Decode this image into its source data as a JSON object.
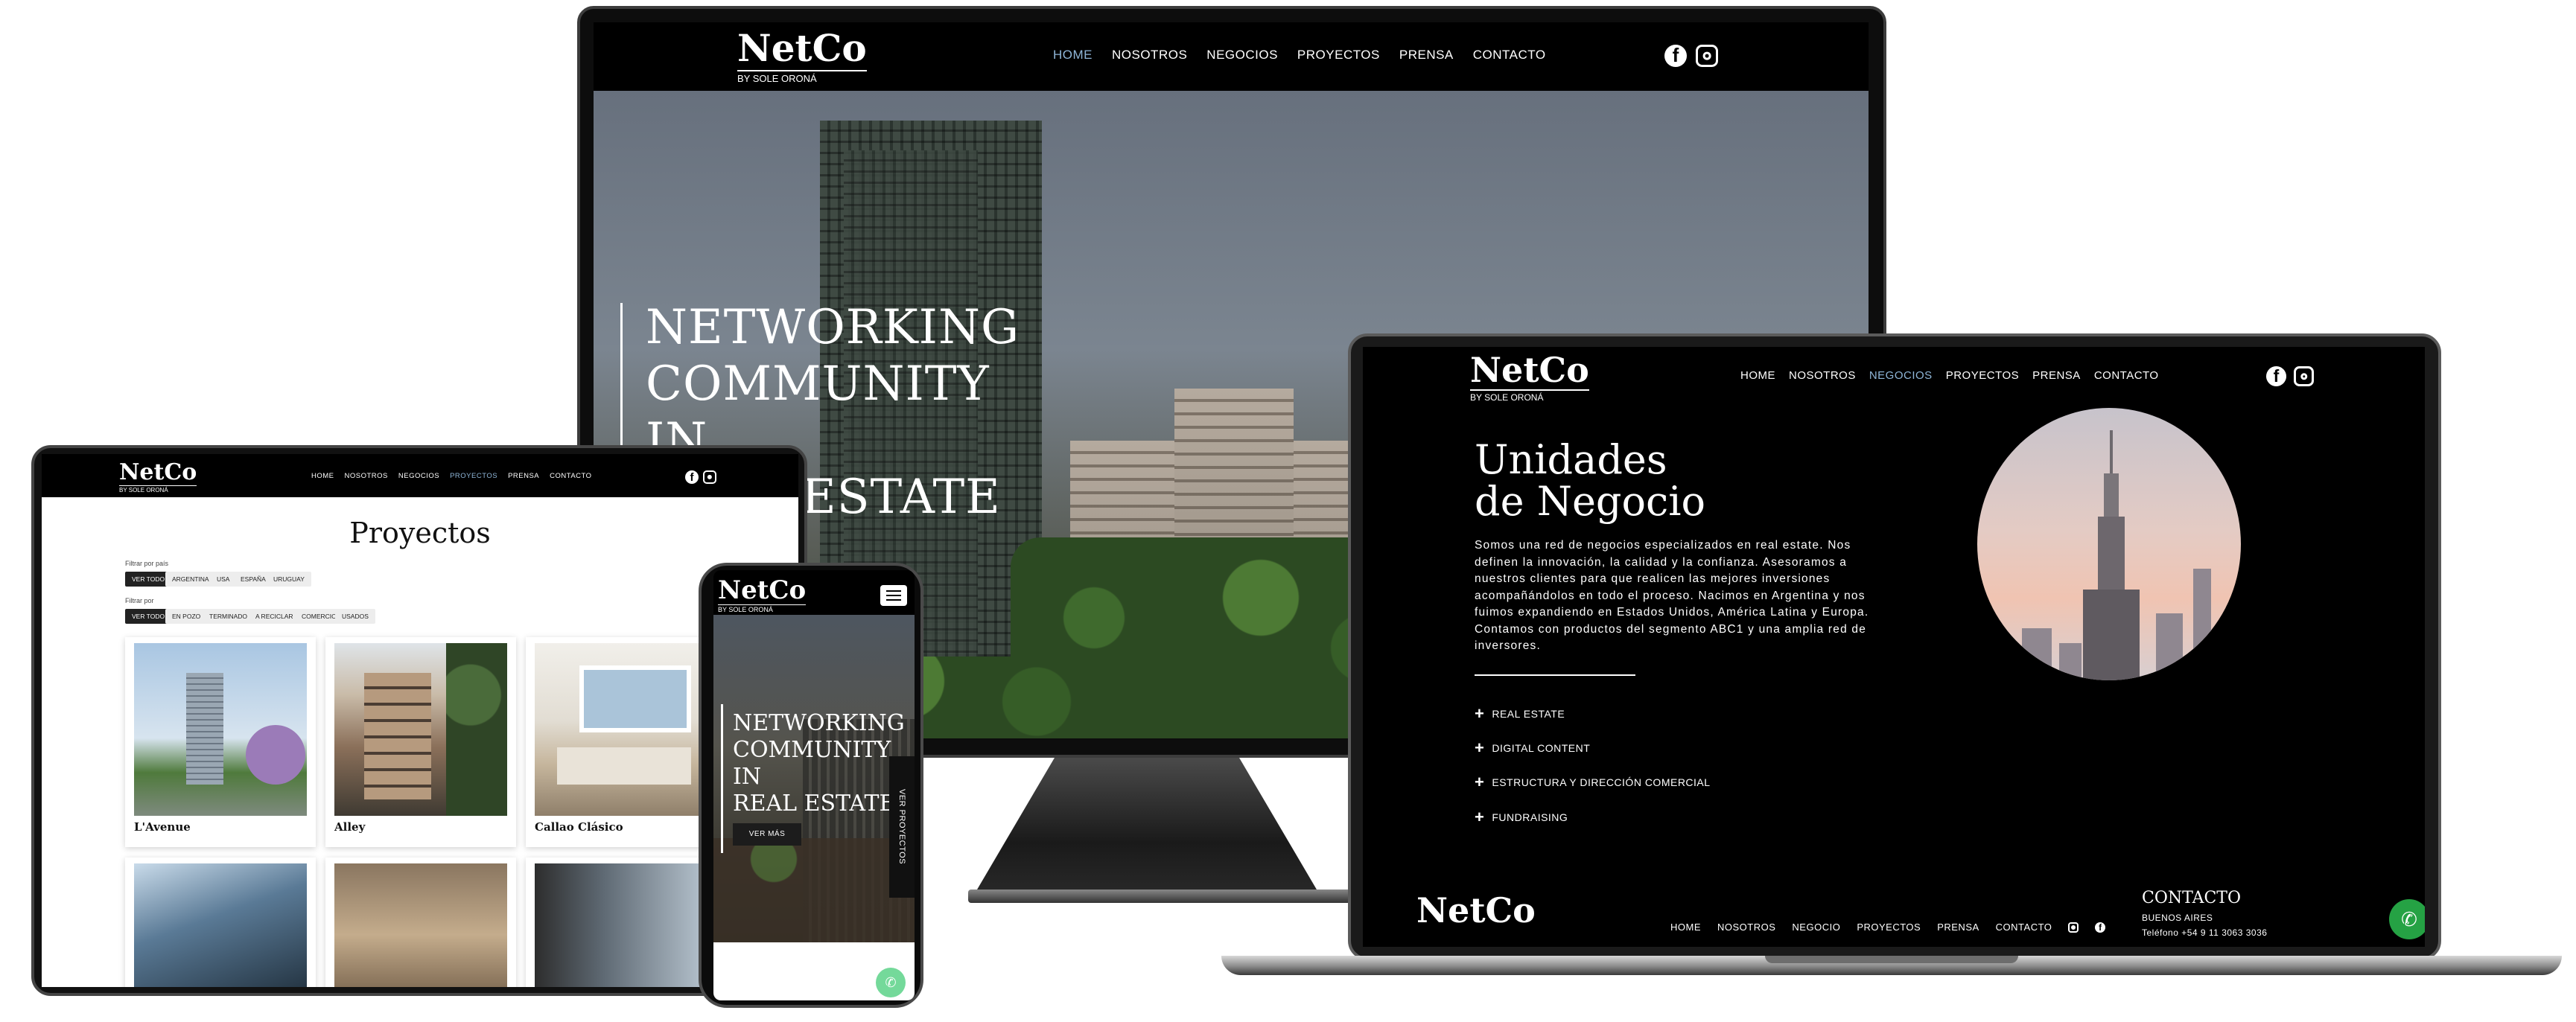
{
  "brand": {
    "logo": "NetCo",
    "tagline": "BY SOLE ORONÁ"
  },
  "nav": {
    "home": "HOME",
    "nosotros": "NOSOTROS",
    "negocios": "NEGOCIOS",
    "proyectos": "PROYECTOS",
    "prensa": "PRENSA",
    "contacto": "CONTACTO"
  },
  "desktop": {
    "active_nav": "HOME",
    "hero_title_lines": [
      "NETWORKING",
      "COMMUNITY",
      "IN",
      "REAL ESTATE"
    ]
  },
  "laptop": {
    "active_nav": "NEGOCIOS",
    "title_line1": "Unidades",
    "title_line2": "de Negocio",
    "body": "Somos una red de negocios especializados en real estate. Nos definen la innovación, la calidad y la confianza. Asesoramos a nuestros clientes para que realicen las mejores inversiones acompañándolos en todo el proceso. Nacimos en Argentina y nos fuimos expandiendo en Estados Unidos, América Latina y Europa. Contamos con productos del segmento ABC1 y una amplia red de inversores.",
    "services": [
      "REAL ESTATE",
      "DIGITAL CONTENT",
      "ESTRUCTURA Y DIRECCIÓN COMERCIAL",
      "FUNDRAISING"
    ],
    "footer": {
      "nav": [
        "HOME",
        "NOSOTROS",
        "NEGOCIO",
        "PROYECTOS",
        "PRENSA",
        "CONTACTO"
      ],
      "contact_title": "CONTACTO",
      "city": "BUENOS AIRES",
      "phone": "Teléfono +54 9 11 3063 3036"
    }
  },
  "tablet": {
    "active_nav": "PROYECTOS",
    "title": "Proyectos",
    "filter_country_label": "Filtrar por país",
    "country_filters": [
      "VER TODO",
      "ARGENTINA",
      "USA",
      "ESPAÑA",
      "URUGUAY"
    ],
    "filter_by_label": "Filtrar por",
    "status_filters": [
      "VER TODO",
      "EN POZO",
      "TERMINADO",
      "A RECICLAR",
      "COMERCIO",
      "USADOS"
    ],
    "projects": [
      "L'Avenue",
      "Alley",
      "Callao Clásico"
    ]
  },
  "phone": {
    "hero_title_lines": [
      "NETWORKING",
      "COMMUNITY",
      "IN",
      "REAL ESTATE"
    ],
    "cta": "VER MÁS",
    "side_tab": "VER PROYECTOS"
  },
  "colors": {
    "accent_nav": "#8fb6d8",
    "whatsapp": "#25a244",
    "background": "#000000"
  }
}
